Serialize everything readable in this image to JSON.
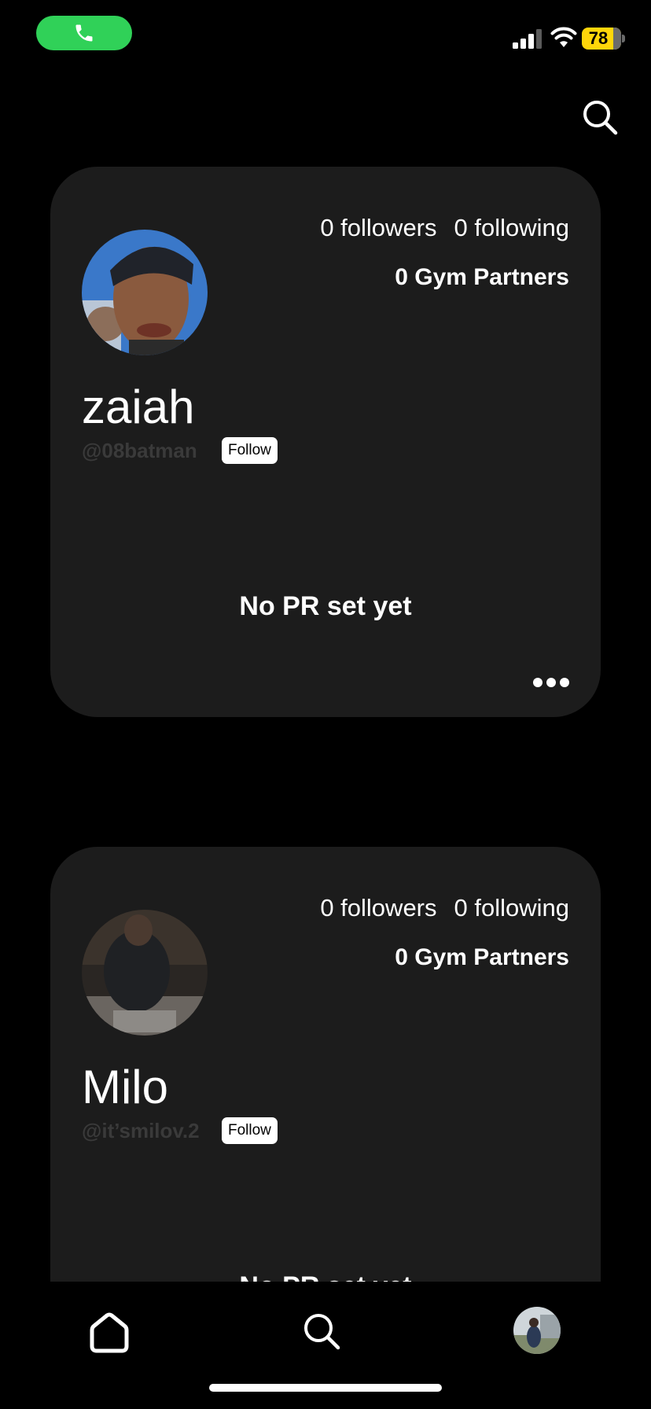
{
  "status_bar": {
    "battery": "78",
    "call_icon": "phone-icon",
    "signal_icon": "cellular-signal-icon",
    "wifi_icon": "wifi-icon"
  },
  "header": {
    "search_icon": "search-icon"
  },
  "profiles": [
    {
      "followers": "0 followers",
      "following": "0 following",
      "gym_partners": "0 Gym Partners",
      "display_name": "zaiah",
      "username": "@08batman",
      "follow_label": "Follow",
      "pr_text": "No PR set yet"
    },
    {
      "followers": "0 followers",
      "following": "0 following",
      "gym_partners": "0 Gym Partners",
      "display_name": "Milo",
      "username": "@it’smilov.2",
      "follow_label": "Follow",
      "pr_text": "No PR set yet"
    }
  ],
  "tab_bar": {
    "items": [
      "home-icon",
      "search-icon",
      "profile-avatar"
    ]
  },
  "colors": {
    "background": "#000000",
    "card": "#1c1c1c",
    "call_pill": "#30d158",
    "battery": "#ffd60a",
    "username": "#3a3a3a"
  }
}
